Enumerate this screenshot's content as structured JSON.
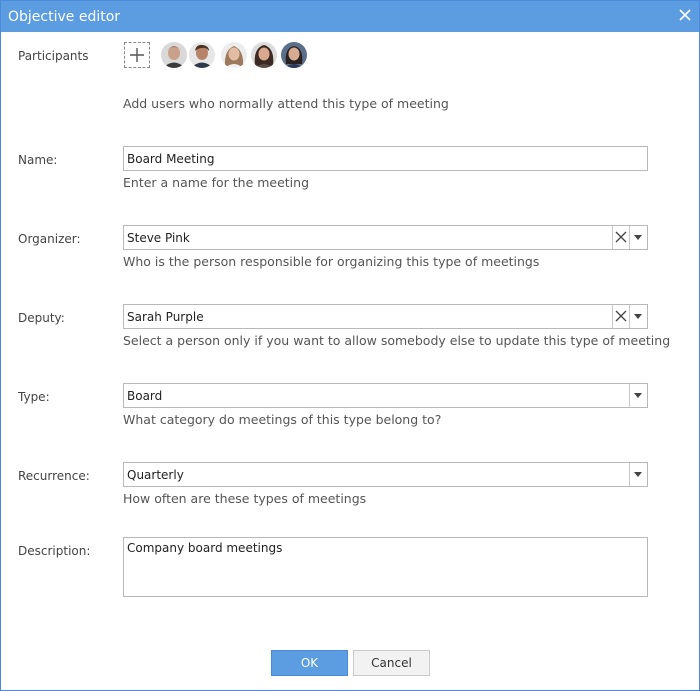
{
  "dialog": {
    "title": "Objective editor",
    "accent_color": "#5b9de0",
    "close_icon": "close-icon"
  },
  "participants": {
    "label": "Participants",
    "add_icon": "plus-icon",
    "avatars": [
      "avatar-1",
      "avatar-2",
      "avatar-3",
      "avatar-4",
      "avatar-5"
    ],
    "hint": "Add users who normally attend this type of meeting"
  },
  "name": {
    "label": "Name:",
    "value": "Board Meeting",
    "hint": "Enter a name for the meeting"
  },
  "organizer": {
    "label": "Organizer:",
    "value": "Steve Pink",
    "hint": "Who is the person responsible for organizing this type of meetings"
  },
  "deputy": {
    "label": "Deputy:",
    "value": "Sarah Purple",
    "hint": "Select a person only if you want to allow somebody else to update this type of meeting"
  },
  "type": {
    "label": "Type:",
    "value": "Board",
    "hint": "What category do meetings of this type belong to?"
  },
  "recurrence": {
    "label": "Recurrence:",
    "value": "Quarterly",
    "hint": "How often are these types of meetings"
  },
  "description": {
    "label": "Description:",
    "value": "Company board meetings"
  },
  "footer": {
    "ok_label": "OK",
    "cancel_label": "Cancel"
  }
}
